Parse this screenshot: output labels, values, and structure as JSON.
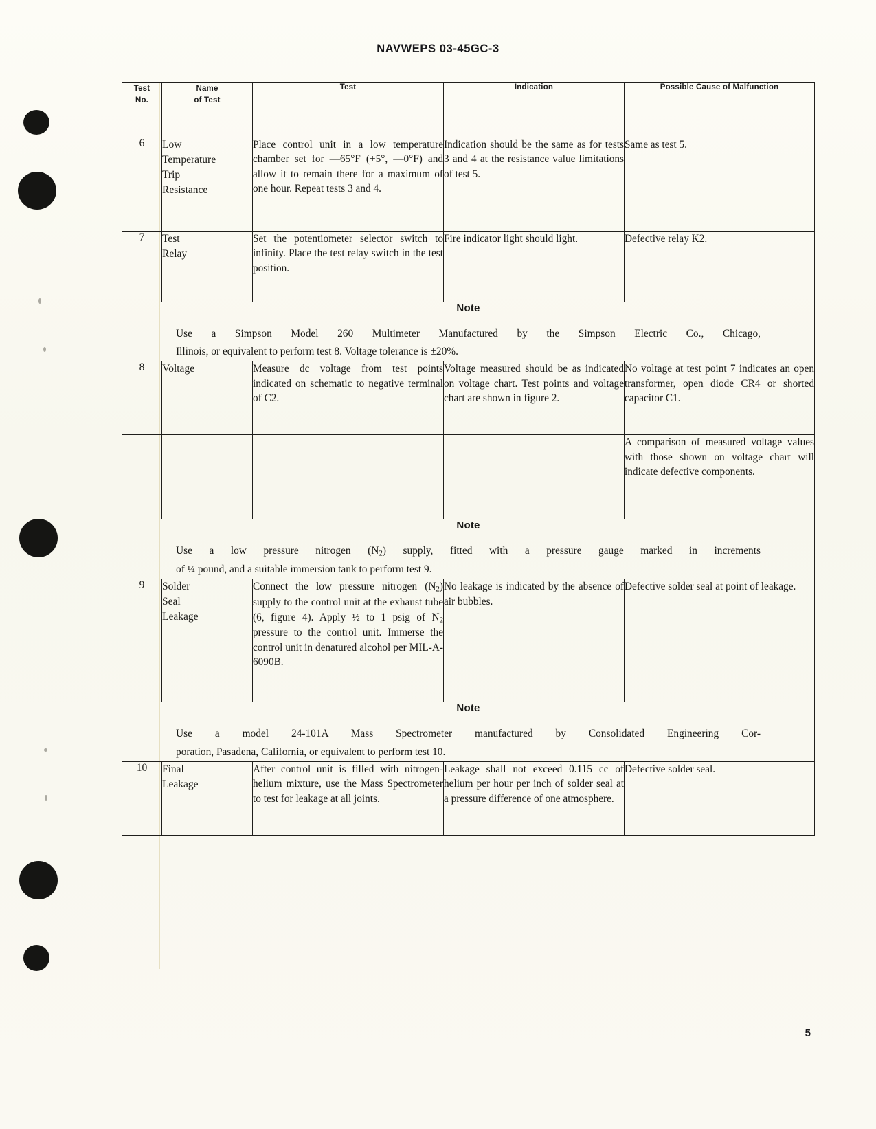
{
  "document": {
    "running_head": "NAVWEPS 03-45GC-3",
    "page_number": "5"
  },
  "table": {
    "headers": {
      "test_no": [
        "Test",
        "No."
      ],
      "name_of_test": [
        "Name",
        "of Test"
      ],
      "test": "Test",
      "indication": "Indication",
      "possible_cause": "Possible Cause of Malfunction"
    },
    "rows": [
      {
        "type": "test",
        "no": "6",
        "name": "Low\nTemperature\nTrip\nResistance",
        "test": "Place control unit in a low temperature chamber set for —65°F (+5°, —0°F) and allow it to remain there for a maximum of one hour. Repeat tests 3 and 4.",
        "indication": "Indication should be the same as for tests 3 and 4 at the resistance value limitations of test 5.",
        "cause": "Same as test 5."
      },
      {
        "type": "test",
        "no": "7",
        "name": "Test\nRelay",
        "test": "Set the potentiometer selector switch to infinity. Place the test relay switch in the test position.",
        "indication": "Fire indicator light should light.",
        "cause": "Defective relay K2."
      },
      {
        "type": "note",
        "title": "Note",
        "line1": "Use a Simpson Model 260 Multimeter Manufactured by the Simpson Electric Co., Chicago,",
        "line2": "Illinois, or equivalent to perform test 8. Voltage tolerance is ±20%."
      },
      {
        "type": "test",
        "no": "8",
        "name": "Voltage",
        "test": "Measure dc voltage from test points indicated on schematic to negative terminal of C2.",
        "indication": "Voltage measured should be as indicated on voltage chart. Test points and voltage chart are shown in figure 2.",
        "cause": "No voltage at test point 7 indicates an open transformer, open diode CR4 or shorted capacitor C1."
      },
      {
        "type": "test-cont",
        "no": "",
        "name": "",
        "test": "",
        "indication": "",
        "cause": "A comparison of measured voltage values with those shown on voltage chart will indicate defective components."
      },
      {
        "type": "note",
        "title": "Note",
        "line1": "Use a low pressure nitrogen (N2) supply, fitted with a pressure gauge marked in increments",
        "line2": "of ¼ pound, and a suitable immersion tank to perform test 9."
      },
      {
        "type": "test",
        "no": "9",
        "name": "Solder\nSeal\nLeakage",
        "test": "Connect the low pressure nitrogen (N2) supply to the control unit at the exhaust tube (6, figure 4). Apply ½ to 1 psig of N2 pressure to the control unit. Immerse the control unit in denatured alcohol per MIL-A-6090B.",
        "indication": "No leakage is indicated by the absence of air bubbles.",
        "cause": "Defective solder seal at point of leakage."
      },
      {
        "type": "note",
        "title": "Note",
        "line1": "Use a model 24-101A Mass Spectrometer manufactured by Consolidated Engineering Cor-",
        "line2": "poration, Pasadena, California, or equivalent to perform test 10."
      },
      {
        "type": "test",
        "no": "10",
        "name": "Final\nLeakage",
        "test": "After control unit is filled with nitrogen-helium mixture, use the Mass Spectrometer to test for leakage at all joints.",
        "indication": "Leakage shall not exceed 0.115 cc of helium per hour per inch of solder seal at a pressure difference of one atmosphere.",
        "cause": "Defective solder seal."
      }
    ]
  },
  "colors": {
    "paper": "#fbfaf3",
    "ink": "#1a1a17",
    "rule": "#201f1c"
  }
}
